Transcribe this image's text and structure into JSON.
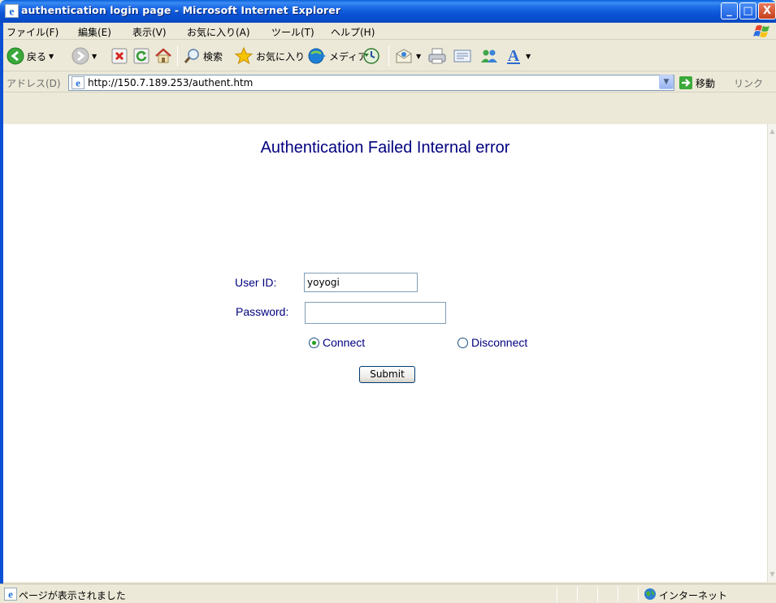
{
  "window": {
    "title": "authentication login page - Microsoft Internet Explorer",
    "controls": {
      "minimize": "_",
      "maximize": "□",
      "close": "X"
    }
  },
  "menu": {
    "items": [
      "ファイル(F)",
      "編集(E)",
      "表示(V)",
      "お気に入り(A)",
      "ツール(T)",
      "ヘルプ(H)"
    ]
  },
  "toolbar": {
    "back_label": "戻る",
    "search_label": "検索",
    "favorites_label": "お気に入り",
    "media_label": "メディア"
  },
  "address": {
    "label": "アドレス(D)",
    "url": "http://150.7.189.253/authent.htm",
    "go_label": "移動",
    "links_label": "リンク"
  },
  "page": {
    "heading": "Authentication Failed Internal error",
    "user_id_label": "User ID:",
    "user_id_value": "yoyogi",
    "password_label": "Password:",
    "password_value": "",
    "radio_connect": "Connect",
    "radio_disconnect": "Disconnect",
    "selected_option": "Connect",
    "submit_label": "Submit"
  },
  "status": {
    "text": "ページが表示されました",
    "zone": "インターネット"
  },
  "colors": {
    "title_bar": "#0a54d6",
    "page_text": "#000080",
    "radio_dot": "#21a121"
  }
}
